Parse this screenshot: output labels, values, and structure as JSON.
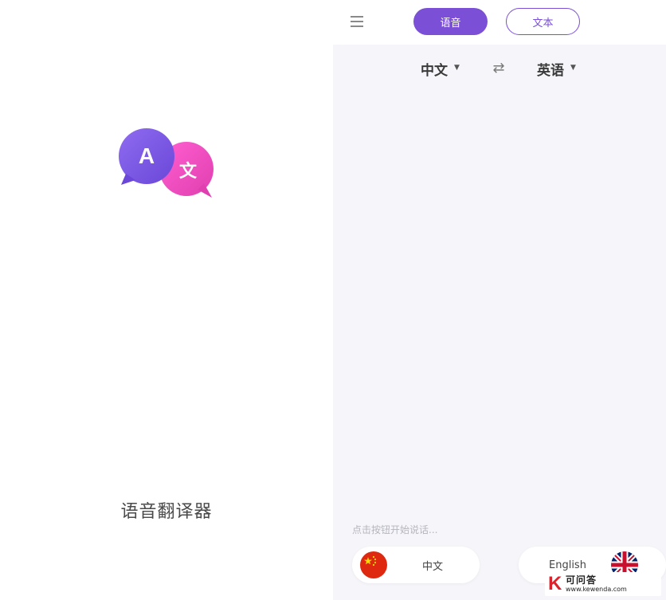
{
  "splash": {
    "app_name": "语音翻译器",
    "logo": {
      "bubble_left_letter": "A",
      "bubble_right_letter": "文",
      "icon": "translate-bubbles-logo"
    }
  },
  "translator": {
    "menu_icon": "hamburger-menu-icon",
    "tabs": [
      {
        "label": "语音",
        "active": true
      },
      {
        "label": "文本",
        "active": false
      }
    ],
    "source_language": "中文",
    "target_language": "英语",
    "swap_icon": "swap-arrows-icon",
    "hint": "点击按钮开始说话...",
    "speak_buttons": [
      {
        "label": "中文",
        "flag": "china-flag-icon"
      },
      {
        "label": "English",
        "flag": "uk-flag-icon"
      }
    ],
    "colors": {
      "accent": "#7b4fd6",
      "background": "#f6f6fa"
    }
  },
  "watermark": {
    "title": "可问答",
    "url": "www.kewenda.com",
    "logo_letter": "K"
  }
}
